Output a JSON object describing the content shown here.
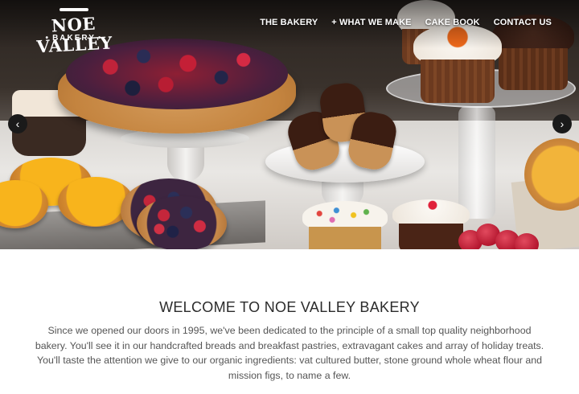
{
  "brand": {
    "name": "NOE VALLEY",
    "sub": "BAKERY"
  },
  "nav": {
    "items": [
      {
        "label": "THE BAKERY",
        "prefix": ""
      },
      {
        "label": "WHAT WE MAKE",
        "prefix": "+"
      },
      {
        "label": "CAKE BOOK",
        "prefix": ""
      },
      {
        "label": "CONTACT US",
        "prefix": ""
      }
    ]
  },
  "hero": {
    "prev_glyph": "‹",
    "next_glyph": "›"
  },
  "welcome": {
    "title": "WELCOME TO NOE VALLEY BAKERY",
    "text": "Since we opened our doors in 1995, we've been dedicated to the principle of a small top quality neighborhood bakery. You'll see it in our handcrafted breads and breakfast pastries, extravagant cakes and array of holiday treats. You'll taste the attention we give to our organic ingredients: vat cultured butter, stone ground whole wheat flour and mission figs, to name a few."
  },
  "colors": {
    "text_dark": "#2b2b2b",
    "text_body": "#555555",
    "nav_text": "#ffffff",
    "arrow_bg": "#1a1a1a"
  },
  "icons": {
    "prev": "chevron-left-icon",
    "next": "chevron-right-icon",
    "logo_mark": "whisk-icon"
  }
}
